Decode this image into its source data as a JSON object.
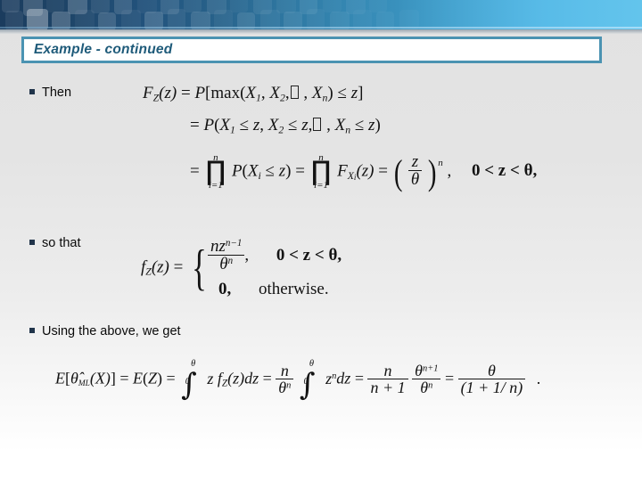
{
  "slide": {
    "title": "Example - continued",
    "theme": {
      "banner_dark": "#1b3c5e",
      "banner_light": "#63c4ec",
      "title_border": "#4b93b2",
      "title_text_color": "#1f5b7a",
      "bullet_color": "#20344a",
      "body_text_color": "#0a0a0a"
    },
    "bullets": [
      {
        "marker": "square-bullet",
        "label": "Then"
      },
      {
        "marker": "square-bullet",
        "label": "so that"
      },
      {
        "marker": "square-bullet",
        "label": "Using the above, we get"
      }
    ],
    "equations": {
      "cdf_line1": {
        "lhs_F": "F",
        "lhs_sub": "Z",
        "lhs_arg": "(z)",
        "eq": "=",
        "P": "P",
        "open": "[",
        "max": "max",
        "max_open": "(",
        "x1": "X",
        "x1_sub": "1",
        "x2": "X",
        "x2_sub": "2",
        "ellipsis_glyph": "missing-glyph-box",
        "xn": "X",
        "xn_sub": "n",
        "max_close": ")",
        "le": "≤",
        "z": "z",
        "close": "]",
        "comma": ","
      },
      "cdf_line2": {
        "eq": "=",
        "P": "P",
        "open": "(",
        "x1": "X",
        "x1_sub": "1",
        "le1": "≤",
        "z1": "z",
        "x2": "X",
        "x2_sub": "2",
        "le2": "≤",
        "z2": "z",
        "ellipsis_glyph": "missing-glyph-box",
        "xn": "X",
        "xn_sub": "n",
        "le3": "≤",
        "z3": "z",
        "close": ")",
        "comma": ","
      },
      "cdf_line3": {
        "eq1": "=",
        "prod1_top": "n",
        "prod1_bot": "i=1",
        "P": "P",
        "p_open": "(",
        "xi": "X",
        "xi_sub": "i",
        "le": "≤",
        "z": "z",
        "p_close": ")",
        "eq2": "=",
        "prod2_top": "n",
        "prod2_bot": "i=1",
        "F": "F",
        "F_sub_X": "X",
        "F_sub_i": "i",
        "F_arg": "(z)",
        "eq3": "=",
        "frac_num": "z",
        "frac_den": "θ",
        "power": "n",
        "comma1": ",",
        "range": "0 < z < θ,"
      },
      "pdf_line": {
        "lhs_f": "f",
        "lhs_sub": "Z",
        "lhs_arg": "(z)",
        "eq": "=",
        "case1_num_n": "n",
        "case1_num_z": "z",
        "case1_num_exp": "n−1",
        "case1_den": "θ",
        "case1_den_exp": "n",
        "case1_comma": ",",
        "case1_cond": "0 < z < θ,",
        "case2_value": "0,",
        "case2_cond": "otherwise."
      },
      "expectation_line": {
        "E1": "E",
        "open1": "[",
        "theta_hat": "θ̂",
        "sub_ML": "ML",
        "argX": "(X)",
        "close1": "]",
        "eq1": "=",
        "E2": "E",
        "open2": "(",
        "Z": "Z",
        "close2": ")",
        "eq2": "=",
        "int1_upper": "θ",
        "int1_lower": "0",
        "z": "z",
        "f": "f",
        "f_sub": "Z",
        "f_arg": "(z)",
        "dz": "dz",
        "eq3": "=",
        "frac1_num": "n",
        "frac1_den": "θ",
        "frac1_den_exp": "n",
        "int2_upper": "θ",
        "int2_lower": "0",
        "zn": "z",
        "zn_exp": "n",
        "dz2": "dz",
        "eq4": "=",
        "frac2_num": "n",
        "frac2_den": "n + 1",
        "frac3_num": "θ",
        "frac3_num_exp": "n+1",
        "frac3_den": "θ",
        "frac3_den_exp": "n",
        "eq5": "=",
        "frac4_num": "θ",
        "frac4_den": "(1 + 1/ n)",
        "period": "."
      }
    }
  }
}
